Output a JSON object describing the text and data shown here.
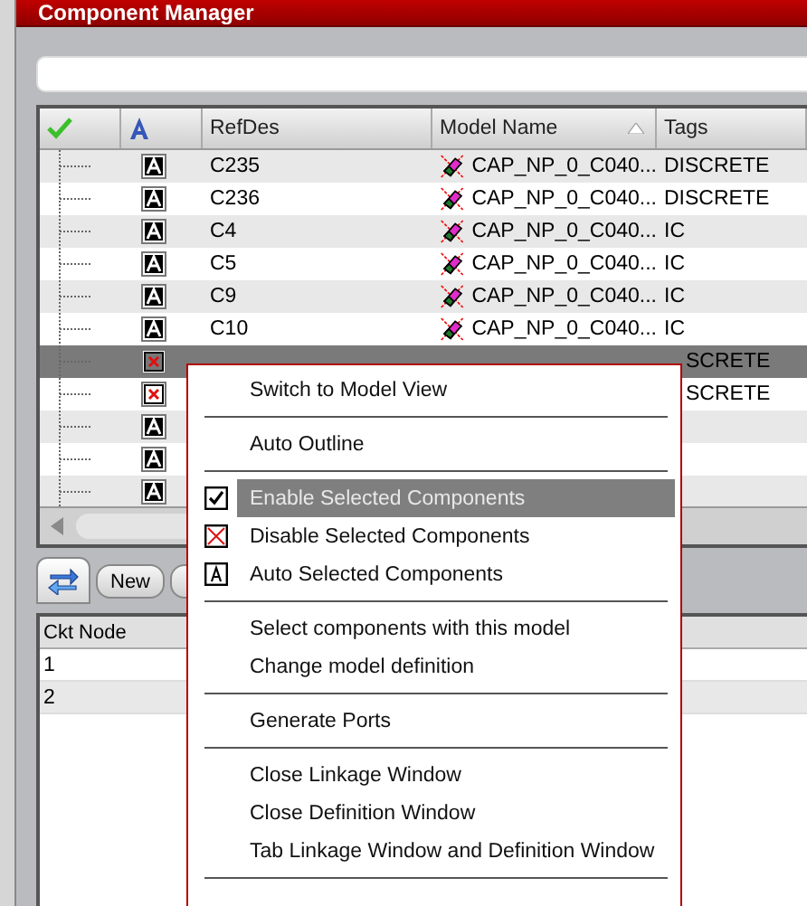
{
  "window": {
    "title": "Component Manager"
  },
  "table": {
    "columns": [
      "RefDes",
      "Model Name",
      "Tags"
    ],
    "rows": [
      {
        "kind": "auto",
        "refdes": "C235",
        "model": "CAP_NP_0_C040...",
        "tags": "DISCRETE",
        "selected": false
      },
      {
        "kind": "auto",
        "refdes": "C236",
        "model": "CAP_NP_0_C040...",
        "tags": "DISCRETE",
        "selected": false
      },
      {
        "kind": "auto",
        "refdes": "C4",
        "model": "CAP_NP_0_C040...",
        "tags": "IC",
        "selected": false
      },
      {
        "kind": "auto",
        "refdes": "C5",
        "model": "CAP_NP_0_C040...",
        "tags": "IC",
        "selected": false
      },
      {
        "kind": "auto",
        "refdes": "C9",
        "model": "CAP_NP_0_C040...",
        "tags": "IC",
        "selected": false
      },
      {
        "kind": "auto",
        "refdes": "C10",
        "model": "CAP_NP_0_C040...",
        "tags": "IC",
        "selected": false
      },
      {
        "kind": "disabled",
        "tags": "SCRETE",
        "selected": true
      },
      {
        "kind": "disabled",
        "tags": "SCRETE",
        "selected": false
      },
      {
        "kind": "auto",
        "selected": false
      },
      {
        "kind": "auto",
        "selected": false
      },
      {
        "kind": "auto",
        "selected": false
      }
    ]
  },
  "toolbar": {
    "buttons": [
      "New"
    ]
  },
  "node_table": {
    "columns": [
      "Ckt Node"
    ],
    "rows": [
      "1",
      "2"
    ]
  },
  "context_menu": [
    {
      "kind": "item",
      "label": "Switch to Model View",
      "selected": false
    },
    {
      "kind": "separator"
    },
    {
      "kind": "item",
      "label": "Auto Outline",
      "selected": false
    },
    {
      "kind": "separator"
    },
    {
      "kind": "check",
      "label": "Enable Selected Components",
      "selected": true
    },
    {
      "kind": "cross",
      "label": "Disable Selected Components",
      "selected": false
    },
    {
      "kind": "auto",
      "label": "Auto Selected Components",
      "selected": false
    },
    {
      "kind": "separator"
    },
    {
      "kind": "item",
      "label": "Select components with this model",
      "selected": false
    },
    {
      "kind": "item",
      "label": "Change model definition",
      "selected": false
    },
    {
      "kind": "separator"
    },
    {
      "kind": "item",
      "label": "Generate Ports",
      "selected": false
    },
    {
      "kind": "separator"
    },
    {
      "kind": "item",
      "label": "Close Linkage Window",
      "selected": false
    },
    {
      "kind": "item",
      "label": "Close Definition Window",
      "selected": false
    },
    {
      "kind": "item",
      "label": "Tab Linkage Window and Definition Window",
      "selected": false
    },
    {
      "kind": "separator"
    }
  ]
}
